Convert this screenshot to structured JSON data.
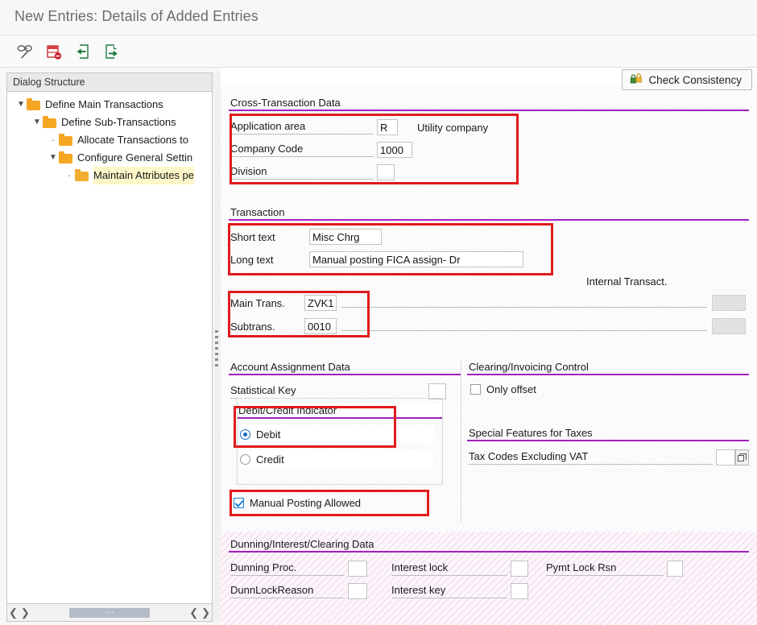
{
  "window": {
    "title": "New Entries: Details of Added Entries"
  },
  "toolbar": {
    "buttons": [
      {
        "name": "display-change-icon",
        "tooltip": "Display/Change"
      },
      {
        "name": "delete-entry-icon",
        "tooltip": "Delete entry"
      },
      {
        "name": "previous-entry-icon",
        "tooltip": "Previous entry"
      },
      {
        "name": "next-entry-icon",
        "tooltip": "Next entry"
      }
    ]
  },
  "tree": {
    "header": "Dialog Structure",
    "nodes": [
      {
        "label": "Define Main Transactions",
        "indent": 0,
        "marker": "expanded",
        "selected": false
      },
      {
        "label": "Define Sub-Transactions",
        "indent": 1,
        "marker": "expanded",
        "selected": false
      },
      {
        "label": "Allocate Transactions to",
        "indent": 2,
        "marker": "leaf",
        "selected": false
      },
      {
        "label": "Configure General Settin",
        "indent": 2,
        "marker": "expanded",
        "selected": false
      },
      {
        "label": "Maintain Attributes pe",
        "indent": 3,
        "marker": "leaf",
        "selected": true
      }
    ]
  },
  "actions": {
    "check_consistency": "Check Consistency"
  },
  "cross_transaction": {
    "title": "Cross-Transaction Data",
    "application_area_label": "Application area",
    "application_area_value": "R",
    "application_area_text": "Utility company",
    "company_code_label": "Company Code",
    "company_code_value": "1000",
    "division_label": "Division",
    "division_value": ""
  },
  "transaction": {
    "title": "Transaction",
    "short_text_label": "Short text",
    "short_text_value": "Misc Chrg",
    "long_text_label": "Long text",
    "long_text_value": "Manual posting FICA assign- Dr",
    "internal_transact_label": "Internal Transact.",
    "main_trans_label": "Main Trans.",
    "main_trans_value": "ZVK1",
    "main_trans_internal": "",
    "subtrans_label": "Subtrans.",
    "subtrans_value": "0010",
    "subtrans_internal": ""
  },
  "account_assignment": {
    "title": "Account Assignment Data",
    "statistical_key_label": "Statistical Key",
    "statistical_key_value": "",
    "debit_credit_title": "Debit/Credit Indicator",
    "debit_label": "Debit",
    "credit_label": "Credit",
    "debit_selected": true,
    "manual_posting_label": "Manual Posting Allowed",
    "manual_posting_checked": true
  },
  "clearing_invoicing": {
    "title": "Clearing/Invoicing Control",
    "only_offset_label": "Only offset",
    "only_offset_checked": false
  },
  "special_taxes": {
    "title": "Special Features for Taxes",
    "tax_codes_label": "Tax Codes Excluding VAT",
    "tax_codes_value": ""
  },
  "dunning": {
    "title": "Dunning/Interest/Clearing Data",
    "dunning_proc_label": "Dunning Proc.",
    "dunning_proc_value": "",
    "interest_lock_label": "Interest lock",
    "interest_lock_value": "",
    "pymt_lock_label": "Pymt Lock Rsn",
    "pymt_lock_value": "",
    "dunn_lock_reason_label": "DunnLockReason",
    "dunn_lock_reason_value": "",
    "interest_key_label": "Interest key",
    "interest_key_value": ""
  },
  "colors": {
    "annotation_red": "#e01b1b",
    "panel_rule_purple": "#a020c0",
    "folder_orange": "#f5a623",
    "selection_yellow": "#fdf6c8",
    "title_grey": "#6a6d70"
  }
}
